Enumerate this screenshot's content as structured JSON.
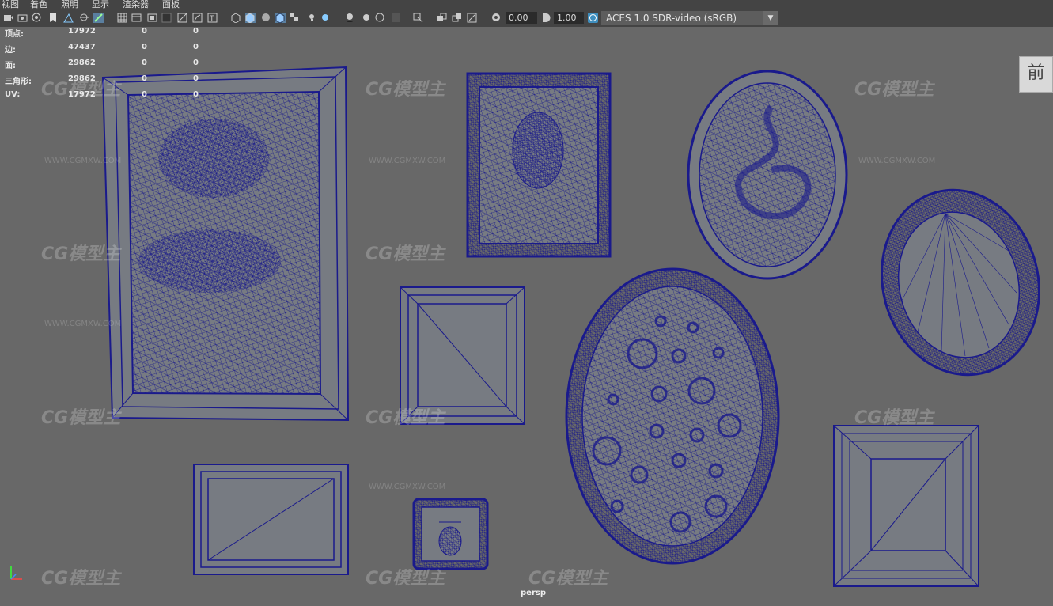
{
  "menu": [
    "视图",
    "着色",
    "照明",
    "显示",
    "渲染器",
    "面板"
  ],
  "toolbar": {
    "exposure": "0.00",
    "gamma": "1.00",
    "color_space": "ACES 1.0 SDR-video (sRGB)"
  },
  "hud": [
    {
      "label": "顶点:",
      "v1": "17972",
      "v2": "0",
      "v3": "0"
    },
    {
      "label": "边:",
      "v1": "47437",
      "v2": "0",
      "v3": "0"
    },
    {
      "label": "面:",
      "v1": "29862",
      "v2": "0",
      "v3": "0"
    },
    {
      "label": "三角形:",
      "v1": "29862",
      "v2": "0",
      "v3": "0"
    },
    {
      "label": "UV:",
      "v1": "17972",
      "v2": "0",
      "v3": "0"
    }
  ],
  "view_cube": "前",
  "camera": "persp",
  "watermark": "CG模型主",
  "watermark_url": "WWW.CGMXW.COM",
  "colors": {
    "wire": "#1a1a8c",
    "mesh": "#767a80",
    "bg": "#686868"
  }
}
